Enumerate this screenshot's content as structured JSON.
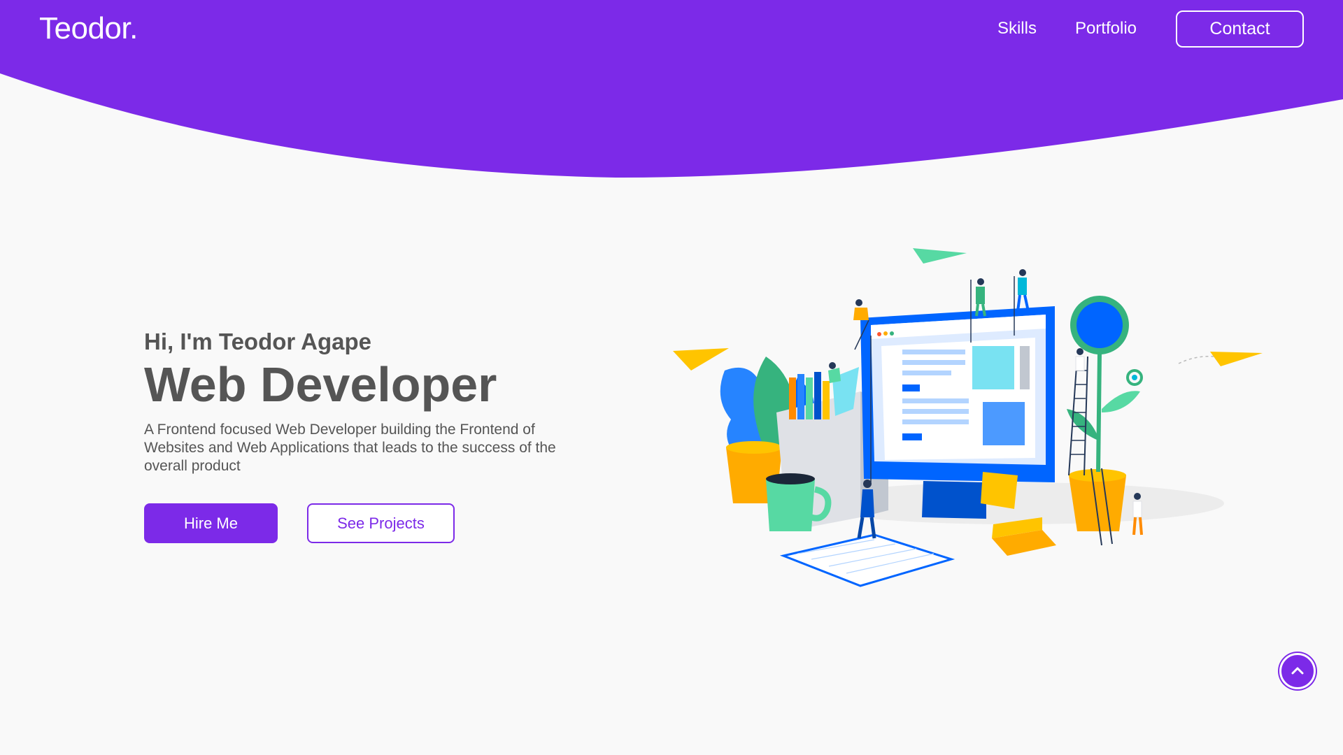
{
  "brand": {
    "logo": "Teodor.",
    "accent_color": "#7c2ae8"
  },
  "nav": {
    "skills": "Skills",
    "portfolio": "Portfolio",
    "contact": "Contact"
  },
  "hero": {
    "greeting": "Hi, I'm Teodor Agape",
    "title": "Web Developer",
    "description": "A Frontend focused Web Developer building the Frontend of Websites and Web Applications that leads to the success of the overall product",
    "primary_button": "Hire Me",
    "secondary_button": "See Projects"
  },
  "illustration": {
    "icon": "web-developer-workspace-illustration"
  },
  "scroll_top": {
    "icon": "chevron-up-icon"
  }
}
